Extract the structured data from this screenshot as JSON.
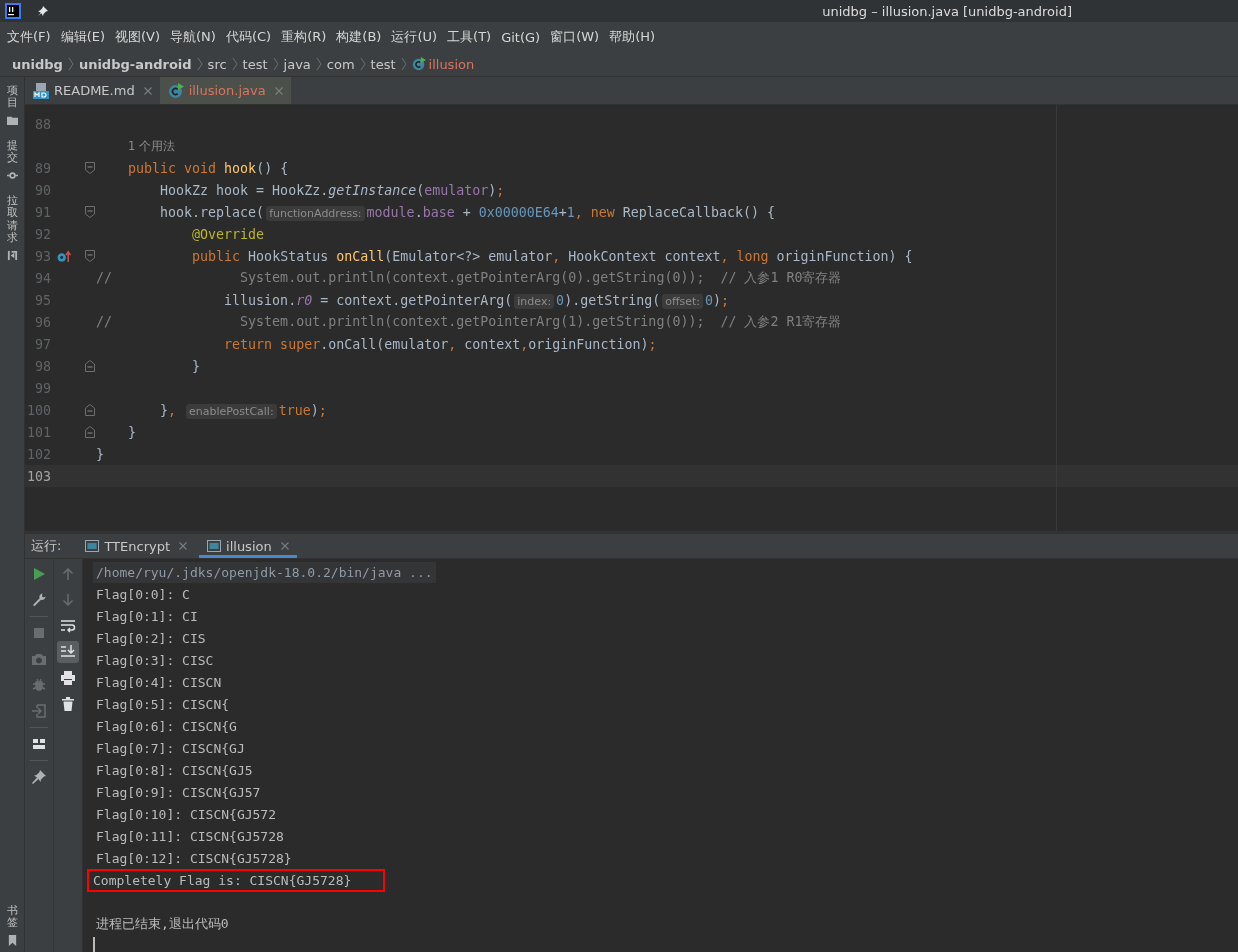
{
  "window": {
    "title": "unidbg – illusion.java [unidbg-android]"
  },
  "menu": [
    "文件(F)",
    "编辑(E)",
    "视图(V)",
    "导航(N)",
    "代码(C)",
    "重构(R)",
    "构建(B)",
    "运行(U)",
    "工具(T)",
    "Git(G)",
    "窗口(W)",
    "帮助(H)"
  ],
  "breadcrumb": [
    {
      "kind": "module",
      "label": "unidbg"
    },
    {
      "kind": "module",
      "label": "unidbg-android"
    },
    {
      "kind": "folder",
      "label": "src"
    },
    {
      "kind": "folder",
      "label": "test"
    },
    {
      "kind": "folder",
      "label": "java"
    },
    {
      "kind": "folder",
      "label": "com"
    },
    {
      "kind": "folder",
      "label": "test"
    },
    {
      "kind": "class",
      "label": "illusion"
    }
  ],
  "side_tools_top": [
    {
      "kind": "project",
      "label": "项目"
    },
    {
      "kind": "commit",
      "label": "提交"
    },
    {
      "kind": "pull",
      "label": "拉取请求"
    }
  ],
  "side_tools_bottom": [
    {
      "kind": "bookmark",
      "label": "书签"
    }
  ],
  "editor_tabs": [
    {
      "kind": "markdown",
      "label": "README.md",
      "selected": false
    },
    {
      "kind": "class",
      "label": "illusion.java",
      "selected": true
    }
  ],
  "code": [
    {
      "kind": "code",
      "number": "88",
      "current": false
    },
    {
      "kind": "usage",
      "text": "1 个用法"
    },
    {
      "kind": "code",
      "number": "89",
      "fold_start": true,
      "current": false,
      "tokens": [
        {
          "kind": "keyword",
          "text": "    public void "
        },
        {
          "kind": "decl",
          "text": "hook"
        },
        {
          "kind": "plain",
          "text": "() {"
        }
      ]
    },
    {
      "kind": "code",
      "number": "90",
      "current": false,
      "tokens": [
        {
          "kind": "plain",
          "text": "        HookZz hook = HookZz."
        },
        {
          "kind": "italic",
          "text": "getInstance"
        },
        {
          "kind": "plain",
          "text": "("
        },
        {
          "kind": "field",
          "text": "emulator"
        },
        {
          "kind": "plain",
          "text": ")"
        },
        {
          "kind": "keyword",
          "text": ";"
        }
      ]
    },
    {
      "kind": "code",
      "number": "91",
      "fold_start": true,
      "current": false,
      "tokens": [
        {
          "kind": "plain",
          "text": "        hook.replace("
        },
        {
          "kind": "hint",
          "text": "functionAddress:"
        },
        {
          "kind": "field",
          "text": "module"
        },
        {
          "kind": "plain",
          "text": "."
        },
        {
          "kind": "field",
          "text": "base"
        },
        {
          "kind": "plain",
          "text": " + "
        },
        {
          "kind": "number",
          "text": "0x00000E64"
        },
        {
          "kind": "plain",
          "text": "+"
        },
        {
          "kind": "number",
          "text": "1"
        },
        {
          "kind": "keyword",
          "text": ", new "
        },
        {
          "kind": "plain",
          "text": "ReplaceCallback() {"
        }
      ]
    },
    {
      "kind": "code",
      "number": "92",
      "current": false,
      "tokens": [
        {
          "kind": "annotation",
          "text": "            @Override"
        }
      ]
    },
    {
      "kind": "code",
      "number": "93",
      "fold_start": true,
      "override_marker": true,
      "current": false,
      "tokens": [
        {
          "kind": "keyword",
          "text": "            public "
        },
        {
          "kind": "plain",
          "text": "HookStatus "
        },
        {
          "kind": "decl",
          "text": "onCall"
        },
        {
          "kind": "plain",
          "text": "(Emulator<?> emulator"
        },
        {
          "kind": "keyword",
          "text": ", "
        },
        {
          "kind": "plain",
          "text": "HookContext context"
        },
        {
          "kind": "keyword",
          "text": ", long "
        },
        {
          "kind": "plain",
          "text": "originFunction) {"
        }
      ]
    },
    {
      "kind": "code",
      "number": "94",
      "current": false,
      "tokens": [
        {
          "kind": "comment",
          "text": "//                System.out.println(context.getPointerArg(0).getString(0));  // 入参1 R0寄存器"
        }
      ]
    },
    {
      "kind": "code",
      "number": "95",
      "current": false,
      "tokens": [
        {
          "kind": "plain",
          "text": "                illusion."
        },
        {
          "kind": "field_italic",
          "text": "r0"
        },
        {
          "kind": "plain",
          "text": " = context.getPointerArg("
        },
        {
          "kind": "hint",
          "text": "index:"
        },
        {
          "kind": "number",
          "text": "0"
        },
        {
          "kind": "plain",
          "text": ").getString("
        },
        {
          "kind": "hint",
          "text": "offset:"
        },
        {
          "kind": "number",
          "text": "0"
        },
        {
          "kind": "plain",
          "text": ")"
        },
        {
          "kind": "keyword",
          "text": ";"
        }
      ]
    },
    {
      "kind": "code",
      "number": "96",
      "current": false,
      "tokens": [
        {
          "kind": "comment",
          "text": "//                System.out.println(context.getPointerArg(1).getString(0));  // 入参2 R1寄存器"
        }
      ]
    },
    {
      "kind": "code",
      "number": "97",
      "current": false,
      "tokens": [
        {
          "kind": "keyword",
          "text": "                return super"
        },
        {
          "kind": "plain",
          "text": ".onCall(emulator"
        },
        {
          "kind": "keyword",
          "text": ", "
        },
        {
          "kind": "plain",
          "text": "context"
        },
        {
          "kind": "keyword",
          "text": ","
        },
        {
          "kind": "plain",
          "text": "originFunction)"
        },
        {
          "kind": "keyword",
          "text": ";"
        }
      ]
    },
    {
      "kind": "code",
      "number": "98",
      "fold_end": true,
      "current": false,
      "tokens": [
        {
          "kind": "plain",
          "text": "            }"
        }
      ]
    },
    {
      "kind": "code",
      "number": "99",
      "current": false
    },
    {
      "kind": "code",
      "number": "100",
      "fold_end": true,
      "current": false,
      "tokens": [
        {
          "kind": "plain",
          "text": "        }"
        },
        {
          "kind": "keyword",
          "text": ", "
        },
        {
          "kind": "hint",
          "text": "enablePostCall:"
        },
        {
          "kind": "keyword",
          "text": "true"
        },
        {
          "kind": "plain",
          "text": ")"
        },
        {
          "kind": "keyword",
          "text": ";"
        }
      ]
    },
    {
      "kind": "code",
      "number": "101",
      "fold_end": true,
      "current": false,
      "tokens": [
        {
          "kind": "plain",
          "text": "    }"
        }
      ]
    },
    {
      "kind": "code",
      "number": "102",
      "current": false,
      "tokens": [
        {
          "kind": "plain",
          "text": "}"
        }
      ]
    },
    {
      "kind": "code",
      "number": "103",
      "current": true
    }
  ],
  "run_panel": {
    "label": "运行:",
    "tabs": [
      {
        "label": "TTEncrypt",
        "selected": false
      },
      {
        "label": "illusion",
        "selected": true
      }
    ],
    "tools_left": [
      {
        "kind": "rerun",
        "disabled": false
      },
      {
        "kind": "settings",
        "disabled": false
      },
      {
        "kind": "separator"
      },
      {
        "kind": "stop",
        "disabled": true
      },
      {
        "kind": "screenshot",
        "disabled": true
      },
      {
        "kind": "debug",
        "disabled": true
      },
      {
        "kind": "exit",
        "disabled": true
      },
      {
        "kind": "separator"
      },
      {
        "kind": "layout",
        "disabled": false
      },
      {
        "kind": "separator"
      },
      {
        "kind": "pin",
        "disabled": false
      }
    ],
    "tools_right": [
      {
        "kind": "up",
        "disabled": true,
        "selected": false
      },
      {
        "kind": "down",
        "disabled": true,
        "selected": false
      },
      {
        "kind": "wrap",
        "disabled": false,
        "selected": false
      },
      {
        "kind": "scroll_end",
        "disabled": false,
        "selected": true
      },
      {
        "kind": "print",
        "disabled": false,
        "selected": false
      },
      {
        "kind": "trash",
        "disabled": false,
        "selected": false
      }
    ],
    "console": [
      {
        "kind": "command",
        "text": "/home/ryu/.jdks/openjdk-18.0.2/bin/java ...",
        "boxed": false
      },
      {
        "kind": "output",
        "text": "Flag[0:0]: C",
        "boxed": false
      },
      {
        "kind": "output",
        "text": "Flag[0:1]: CI",
        "boxed": false
      },
      {
        "kind": "output",
        "text": "Flag[0:2]: CIS",
        "boxed": false
      },
      {
        "kind": "output",
        "text": "Flag[0:3]: CISC",
        "boxed": false
      },
      {
        "kind": "output",
        "text": "Flag[0:4]: CISCN",
        "boxed": false
      },
      {
        "kind": "output",
        "text": "Flag[0:5]: CISCN{",
        "boxed": false
      },
      {
        "kind": "output",
        "text": "Flag[0:6]: CISCN{G",
        "boxed": false
      },
      {
        "kind": "output",
        "text": "Flag[0:7]: CISCN{GJ",
        "boxed": false
      },
      {
        "kind": "output",
        "text": "Flag[0:8]: CISCN{GJ5",
        "boxed": false
      },
      {
        "kind": "output",
        "text": "Flag[0:9]: CISCN{GJ57",
        "boxed": false
      },
      {
        "kind": "output",
        "text": "Flag[0:10]: CISCN{GJ572",
        "boxed": false
      },
      {
        "kind": "output",
        "text": "Flag[0:11]: CISCN{GJ5728",
        "boxed": false
      },
      {
        "kind": "output",
        "text": "Flag[0:12]: CISCN{GJ5728}",
        "boxed": false
      },
      {
        "kind": "output",
        "text": "Completely Flag is: CISCN{GJ5728}",
        "boxed": true
      },
      {
        "kind": "blank",
        "boxed": false
      },
      {
        "kind": "output",
        "text": "进程已结束,退出代码0",
        "boxed": false
      },
      {
        "kind": "caret",
        "boxed": false
      }
    ]
  }
}
